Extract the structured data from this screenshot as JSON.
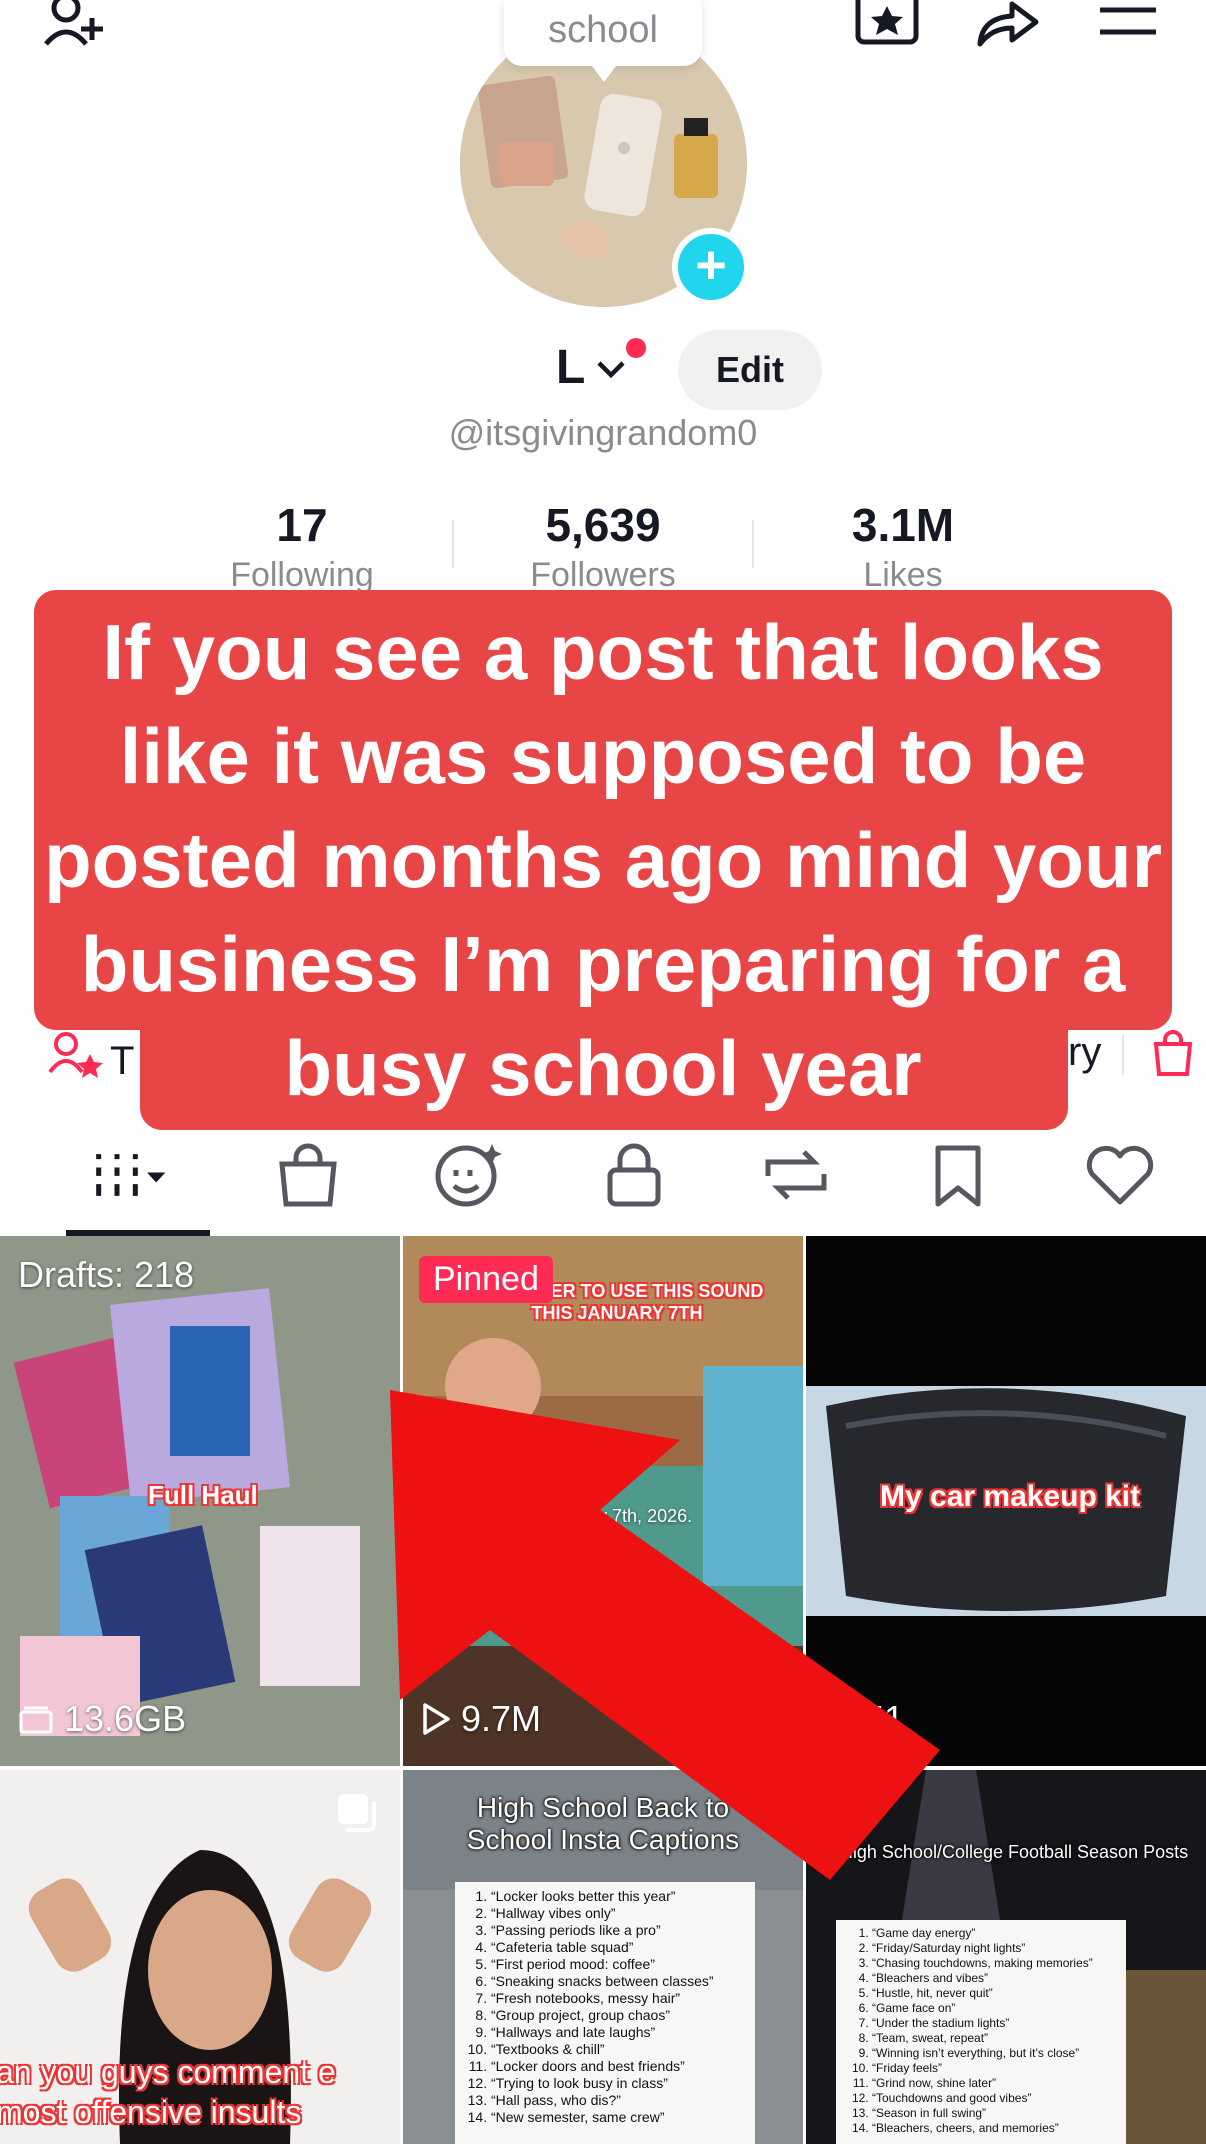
{
  "header": {
    "collection_bubble": "school",
    "display_name": "L",
    "edit_label": "Edit",
    "handle": "@itsgivingrandom0"
  },
  "stats": [
    {
      "value": "17",
      "label": "Following"
    },
    {
      "value": "5,639",
      "label": "Followers"
    },
    {
      "value": "3.1M",
      "label": "Likes"
    }
  ],
  "overlay": {
    "text": "If you see a post that looks like it was supposed to be posted months ago mind your business I’m preparing for a busy school year"
  },
  "under_row": {
    "left_fragment": "T",
    "right_fragment": "ry"
  },
  "tabs": [
    {
      "name": "videos",
      "icon": "grid-icon"
    },
    {
      "name": "shop",
      "icon": "bag-icon"
    },
    {
      "name": "ai-self",
      "icon": "face-sparkle-icon"
    },
    {
      "name": "private",
      "icon": "lock-icon"
    },
    {
      "name": "reposts",
      "icon": "repost-icon"
    },
    {
      "name": "favorites",
      "icon": "bookmark-icon"
    },
    {
      "name": "liked",
      "icon": "heart-icon"
    }
  ],
  "grid": [
    {
      "top_label": "Drafts: 218",
      "overlay_text": "Full Haul",
      "count": "13.6GB",
      "count_icon": "storage-icon"
    },
    {
      "badge": "Pinned",
      "overlay_text": "REMEMBER TO USE THIS SOUND THIS JANUARY 7TH",
      "sub_text": "January 7th, 2026.",
      "count": "9.7M",
      "count_icon": "play-icon"
    },
    {
      "overlay_text": "My car makeup kit",
      "count": "51",
      "count_icon": "play-icon"
    },
    {
      "overlay_text": "an you guys comment e most offensive insults",
      "corner_icon": "multi-photo-icon"
    },
    {
      "title": "High School Back to School Insta Captions",
      "list": [
        "“Locker looks better this year”",
        "“Hallway vibes only”",
        "“Passing periods like a pro”",
        "“Cafeteria table squad”",
        "“First period mood: coffee”",
        "“Sneaking snacks between classes”",
        "“Fresh notebooks, messy hair”",
        "“Group project, group chaos”",
        "“Hallways and late laughs”",
        "“Textbooks & chill”",
        "“Locker doors and best friends”",
        "“Trying to look busy in class”",
        "“Hall pass, who dis?”",
        "“New semester, same crew”"
      ]
    },
    {
      "title": "High School/College Football Season Posts",
      "list": [
        "“Game day energy”",
        "“Friday/Saturday night lights”",
        "“Chasing touchdowns, making memories”",
        "“Bleachers and vibes”",
        "“Hustle, hit, never quit”",
        "“Game face on”",
        "“Under the stadium lights”",
        "“Team, sweat, repeat”",
        "“Winning isn’t everything, but it’s close”",
        "“Friday feels”",
        "“Grind now, shine later”",
        "“Touchdowns and good vibes”",
        "“Season in full swing”",
        "“Bleachers, cheers, and memories”"
      ]
    }
  ],
  "colors": {
    "accent": "#fe2c55",
    "banner": "#e84646",
    "plus": "#20d5ec",
    "arrow": "#ee1111"
  }
}
